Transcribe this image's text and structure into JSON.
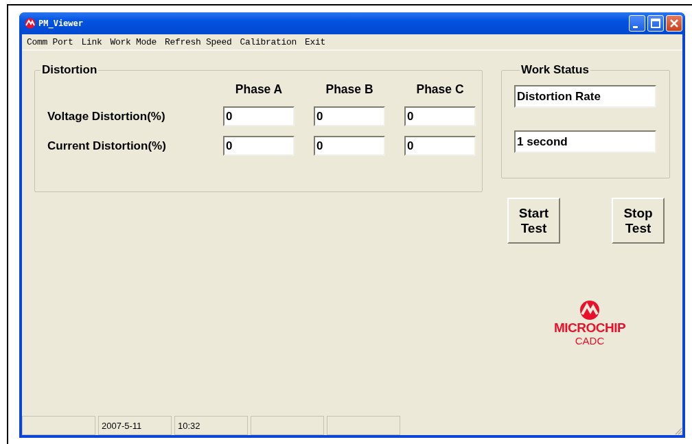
{
  "window": {
    "title": "PM_Viewer"
  },
  "menu": [
    "Comm Port",
    "Link",
    "Work Mode",
    "Refresh Speed",
    "Calibration",
    "Exit"
  ],
  "distortion": {
    "title": "Distortion",
    "columns": [
      "Phase A",
      "Phase B",
      "Phase C"
    ],
    "rows": [
      {
        "label": "Voltage Distortion(%)",
        "values": [
          "0",
          "0",
          "0"
        ]
      },
      {
        "label": "Current Distortion(%)",
        "values": [
          "0",
          "0",
          "0"
        ]
      }
    ]
  },
  "work_status": {
    "title": "Work Status",
    "fields": [
      "Distortion Rate",
      "1 second"
    ]
  },
  "buttons": [
    "Start Test",
    "Stop Test"
  ],
  "logo": {
    "brand": "MICROCHIP",
    "sub": "CADC"
  },
  "status_bar": {
    "date": "2007-5-11",
    "time": "10:32"
  }
}
